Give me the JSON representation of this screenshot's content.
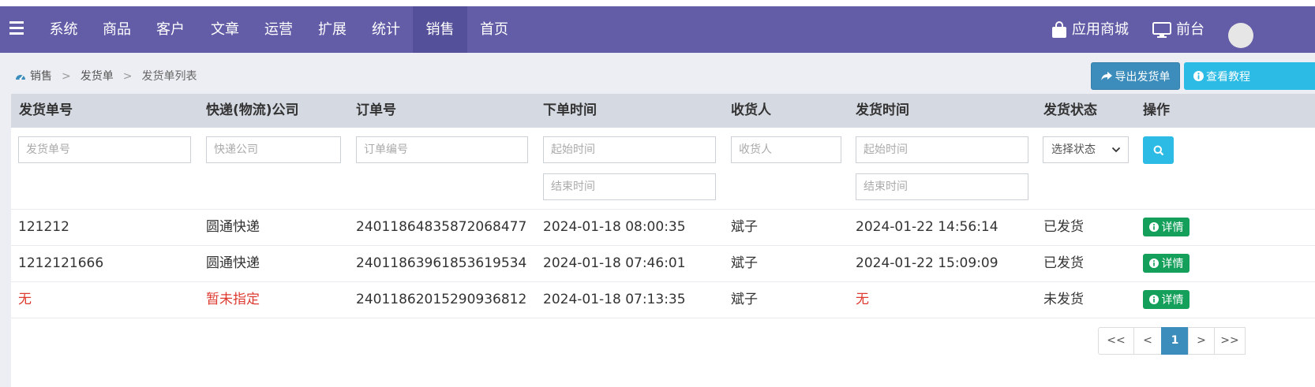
{
  "nav": {
    "items": [
      {
        "label": "系统"
      },
      {
        "label": "商品"
      },
      {
        "label": "客户"
      },
      {
        "label": "文章"
      },
      {
        "label": "运营"
      },
      {
        "label": "扩展"
      },
      {
        "label": "统计"
      },
      {
        "label": "销售",
        "active": true
      },
      {
        "label": "首页"
      }
    ],
    "app_store": "应用商城",
    "frontend": "前台"
  },
  "breadcrumb": {
    "root": "销售",
    "parent": "发货单",
    "current": "发货单列表",
    "sep": ">"
  },
  "actions": {
    "export_label": "导出发货单",
    "help_label": "查看教程"
  },
  "table": {
    "headers": [
      "发货单号",
      "快递(物流)公司",
      "订单号",
      "下单时间",
      "收货人",
      "发货时间",
      "发货状态",
      "操作"
    ],
    "filters": {
      "delivery_no": "发货单号",
      "express_company": "快递公司",
      "order_no": "订单编号",
      "order_start": "起始时间",
      "order_end": "结束时间",
      "consignee": "收货人",
      "ship_start": "起始时间",
      "ship_end": "结束时间",
      "status_selected": "选择状态"
    },
    "rows": [
      {
        "delivery_no": "121212",
        "company": "圆通快递",
        "order_no": "24011864835872068477",
        "order_time": "2024-01-18 08:00:35",
        "consignee": "斌子",
        "ship_time": "2024-01-22 14:56:14",
        "status": "已发货",
        "action": "详情"
      },
      {
        "delivery_no": "1212121666",
        "company": "圆通快递",
        "order_no": "24011863961853619534",
        "order_time": "2024-01-18 07:46:01",
        "consignee": "斌子",
        "ship_time": "2024-01-22 15:09:09",
        "status": "已发货",
        "action": "详情"
      },
      {
        "delivery_no": "无",
        "company": "暂未指定",
        "order_no": "24011862015290936812",
        "order_time": "2024-01-18 07:13:35",
        "consignee": "斌子",
        "ship_time": "无",
        "status": "未发货",
        "action": "详情"
      }
    ]
  },
  "pagination": {
    "first": "<<",
    "prev": "<",
    "current": "1",
    "next": ">",
    "last": ">>"
  },
  "colors": {
    "navbar": "#635ca7",
    "nav_active": "#55509a",
    "primary": "#3c8dbc",
    "info": "#2bbbe4",
    "success": "#14a05b",
    "danger": "#dd3b30"
  }
}
